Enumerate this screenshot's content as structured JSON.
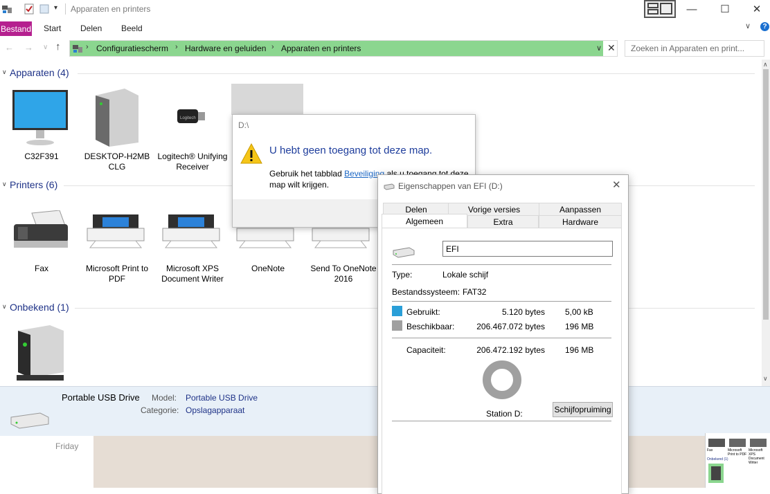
{
  "window": {
    "title": "Apparaten en printers",
    "minimize": "—",
    "maximize": "☐",
    "close": "✕"
  },
  "ribbon": {
    "tabs": [
      "Bestand",
      "Start",
      "Delen",
      "Beeld"
    ],
    "help": "?"
  },
  "address": {
    "crumbs": [
      "Configuratiescherm",
      "Hardware en geluiden",
      "Apparaten en printers"
    ],
    "search_placeholder": "Zoeken in Apparaten en print..."
  },
  "groups": {
    "apparaten": {
      "title": "Apparaten (4)",
      "items": [
        "C32F391",
        "DESKTOP-H2MB CLG",
        "Logitech® Unifying Receiver"
      ]
    },
    "printers": {
      "title": "Printers (6)",
      "items": [
        "Fax",
        "Microsoft Print to PDF",
        "Microsoft XPS Document Writer",
        "OneNote",
        "Send To OneNote 2016"
      ]
    },
    "onbekend": {
      "title": "Onbekend (1)"
    }
  },
  "details": {
    "name": "Portable USB Drive",
    "model_label": "Model:",
    "model_value": "Portable USB Drive",
    "category_label": "Categorie:",
    "category_value": "Opslagapparaat"
  },
  "background": {
    "day": "Friday"
  },
  "error_dialog": {
    "path": "D:\\",
    "heading": "U hebt geen toegang tot deze map.",
    "body_prefix": "Gebruik het tabblad ",
    "body_link": "Beveiliging",
    "body_suffix": " als u toegang tot deze map wilt krijgen."
  },
  "properties": {
    "title": "Eigenschappen van EFI (D:)",
    "tabs_top": [
      "Delen",
      "Vorige versies",
      "Aanpassen"
    ],
    "tabs_bottom": [
      "Algemeen",
      "Extra",
      "Hardware"
    ],
    "name_value": "EFI",
    "type_label": "Type:",
    "type_value": "Lokale schijf",
    "fs_label": "Bestandssysteem:",
    "fs_value": "FAT32",
    "used_label": "Gebruikt:",
    "used_bytes": "5.120 bytes",
    "used_short": "5,00 kB",
    "free_label": "Beschikbaar:",
    "free_bytes": "206.467.072 bytes",
    "free_short": "196 MB",
    "cap_label": "Capaciteit:",
    "cap_bytes": "206.472.192 bytes",
    "cap_short": "196 MB",
    "drive_label": "Station D:",
    "cleanup_button": "Schijfopruiming",
    "used_color": "#2a9fd8",
    "free_color": "#a0a0a0"
  },
  "thumbnail": {
    "labels": [
      "Fax",
      "Microsoft Print to PDF",
      "Microsoft XPS Document Writer",
      "Onbekend (1)"
    ]
  }
}
